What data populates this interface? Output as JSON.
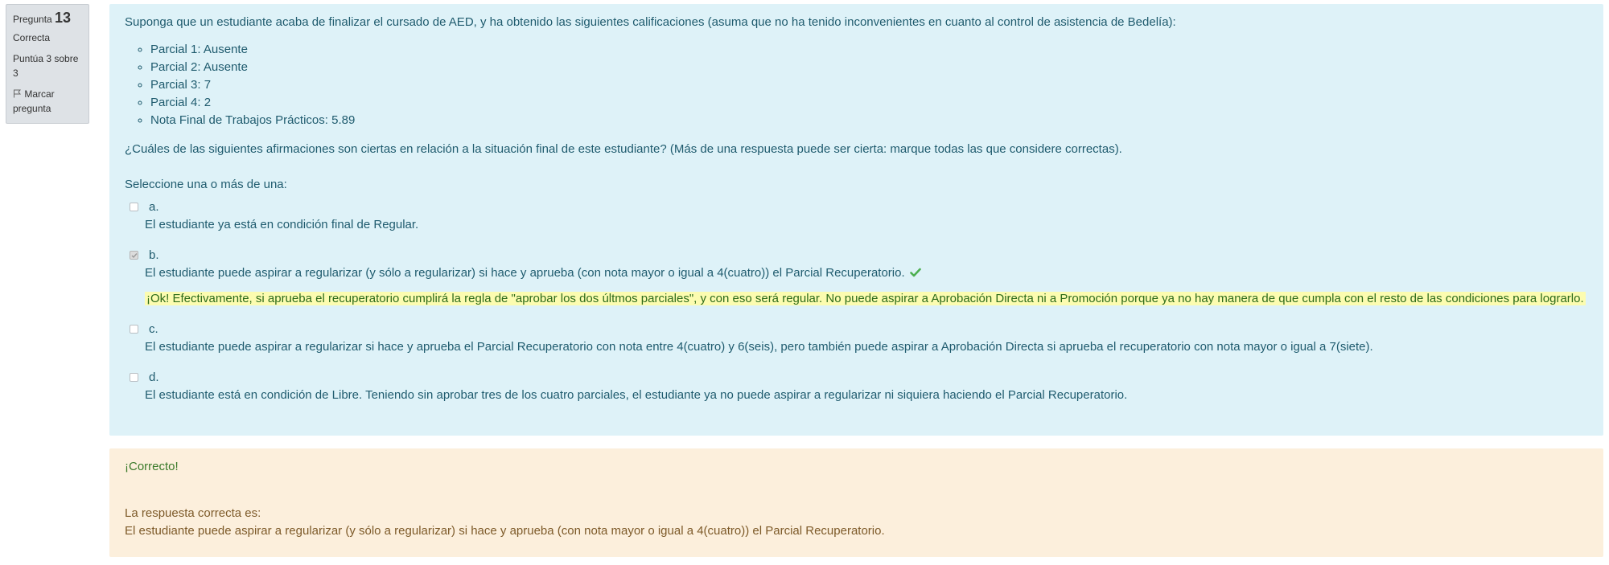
{
  "info": {
    "question_label": "Pregunta",
    "question_number": "13",
    "state": "Correcta",
    "grade": "Puntúa 3 sobre 3",
    "flag_label": "Marcar pregunta"
  },
  "question": {
    "intro": "Suponga que un estudiante acaba de finalizar el cursado de AED, y ha obtenido las siguientes calificaciones (asuma que no ha tenido inconvenientes en cuanto al control de asistencia de Bedelía):",
    "grades": [
      "Parcial 1: Ausente",
      "Parcial 2: Ausente",
      "Parcial 3: 7",
      "Parcial 4: 2",
      "Nota Final de Trabajos Prácticos: 5.89"
    ],
    "question": "¿Cuáles de las siguientes afirmaciones son ciertas en relación a la situación final de este estudiante? (Más de una respuesta puede ser cierta: marque todas las que considere correctas).",
    "prompt": "Seleccione una o más de una:"
  },
  "answers": [
    {
      "letter": "a.",
      "text": "El estudiante ya está en condición final de Regular.",
      "checked": false
    },
    {
      "letter": "b.",
      "text": "El estudiante puede aspirar a regularizar (y sólo a regularizar) si hace y aprueba (con nota mayor o igual a 4(cuatro)) el Parcial Recuperatorio.",
      "checked": true,
      "feedback": "¡Ok! Efectivamente, si aprueba el recuperatorio cumplirá la regla de \"aprobar los dos últmos parciales\", y con eso será regular. No puede aspirar a Aprobación Directa ni a Promoción porque ya no hay manera de que cumpla con el resto de las condiciones para lograrlo."
    },
    {
      "letter": "c.",
      "text": "El estudiante puede aspirar a regularizar si hace y aprueba el Parcial Recuperatorio con nota entre 4(cuatro) y 6(seis), pero también puede aspirar a Aprobación Directa si aprueba el recuperatorio con nota mayor o igual a 7(siete).",
      "checked": false
    },
    {
      "letter": "d.",
      "text": "El estudiante está en condición de Libre. Teniendo sin aprobar tres de los cuatro parciales, el estudiante ya no puede aspirar a regularizar ni siquiera haciendo el Parcial Recuperatorio.",
      "checked": false
    }
  ],
  "outcome": {
    "general_feedback": "¡Correcto!",
    "right_answer_label": "La respuesta correcta es:",
    "right_answer": "El estudiante puede aspirar a regularizar (y sólo a regularizar) si hace y aprueba (con nota mayor o igual a 4(cuatro)) el Parcial Recuperatorio."
  },
  "colors": {
    "formulation_bg": "#def2f8",
    "outcome_bg": "#fcefdc",
    "feedback_highlight": "#fcfcb0",
    "correct_tick": "#4caf50"
  },
  "icons": {
    "flag": "flag-icon",
    "correct": "check-icon"
  }
}
